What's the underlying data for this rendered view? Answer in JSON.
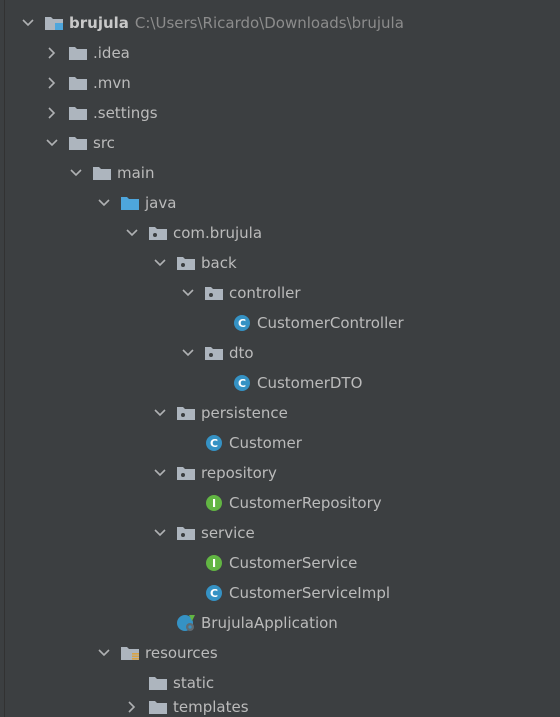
{
  "tree": {
    "root": {
      "label": "brujula",
      "path": "C:\\Users\\Ricardo\\Downloads\\brujula"
    },
    "idea": {
      "label": ".idea"
    },
    "mvn": {
      "label": ".mvn"
    },
    "settings": {
      "label": ".settings"
    },
    "src": {
      "label": "src"
    },
    "main": {
      "label": "main"
    },
    "java": {
      "label": "java"
    },
    "pkg": {
      "label": "com.brujula"
    },
    "back": {
      "label": "back"
    },
    "controller": {
      "label": "controller"
    },
    "customer_controller": {
      "label": "CustomerController"
    },
    "dto": {
      "label": "dto"
    },
    "customer_dto": {
      "label": "CustomerDTO"
    },
    "persistence": {
      "label": "persistence"
    },
    "customer": {
      "label": "Customer"
    },
    "repository": {
      "label": "repository"
    },
    "customer_repository": {
      "label": "CustomerRepository"
    },
    "service": {
      "label": "service"
    },
    "customer_service": {
      "label": "CustomerService"
    },
    "customer_service_impl": {
      "label": "CustomerServiceImpl"
    },
    "app": {
      "label": "BrujulaApplication"
    },
    "resources": {
      "label": "resources"
    },
    "static": {
      "label": "static"
    },
    "templates": {
      "label": "templates"
    }
  },
  "icons": {
    "class_badge": "C",
    "interface_badge": "I"
  },
  "colors": {
    "background": "#3c3f41",
    "text": "#bbbbbb",
    "path_text": "#8c8c8c",
    "folder": "#adb5be",
    "source_folder": "#4ea6dc",
    "class_badge": "#3592c4",
    "interface_badge": "#62b543"
  }
}
